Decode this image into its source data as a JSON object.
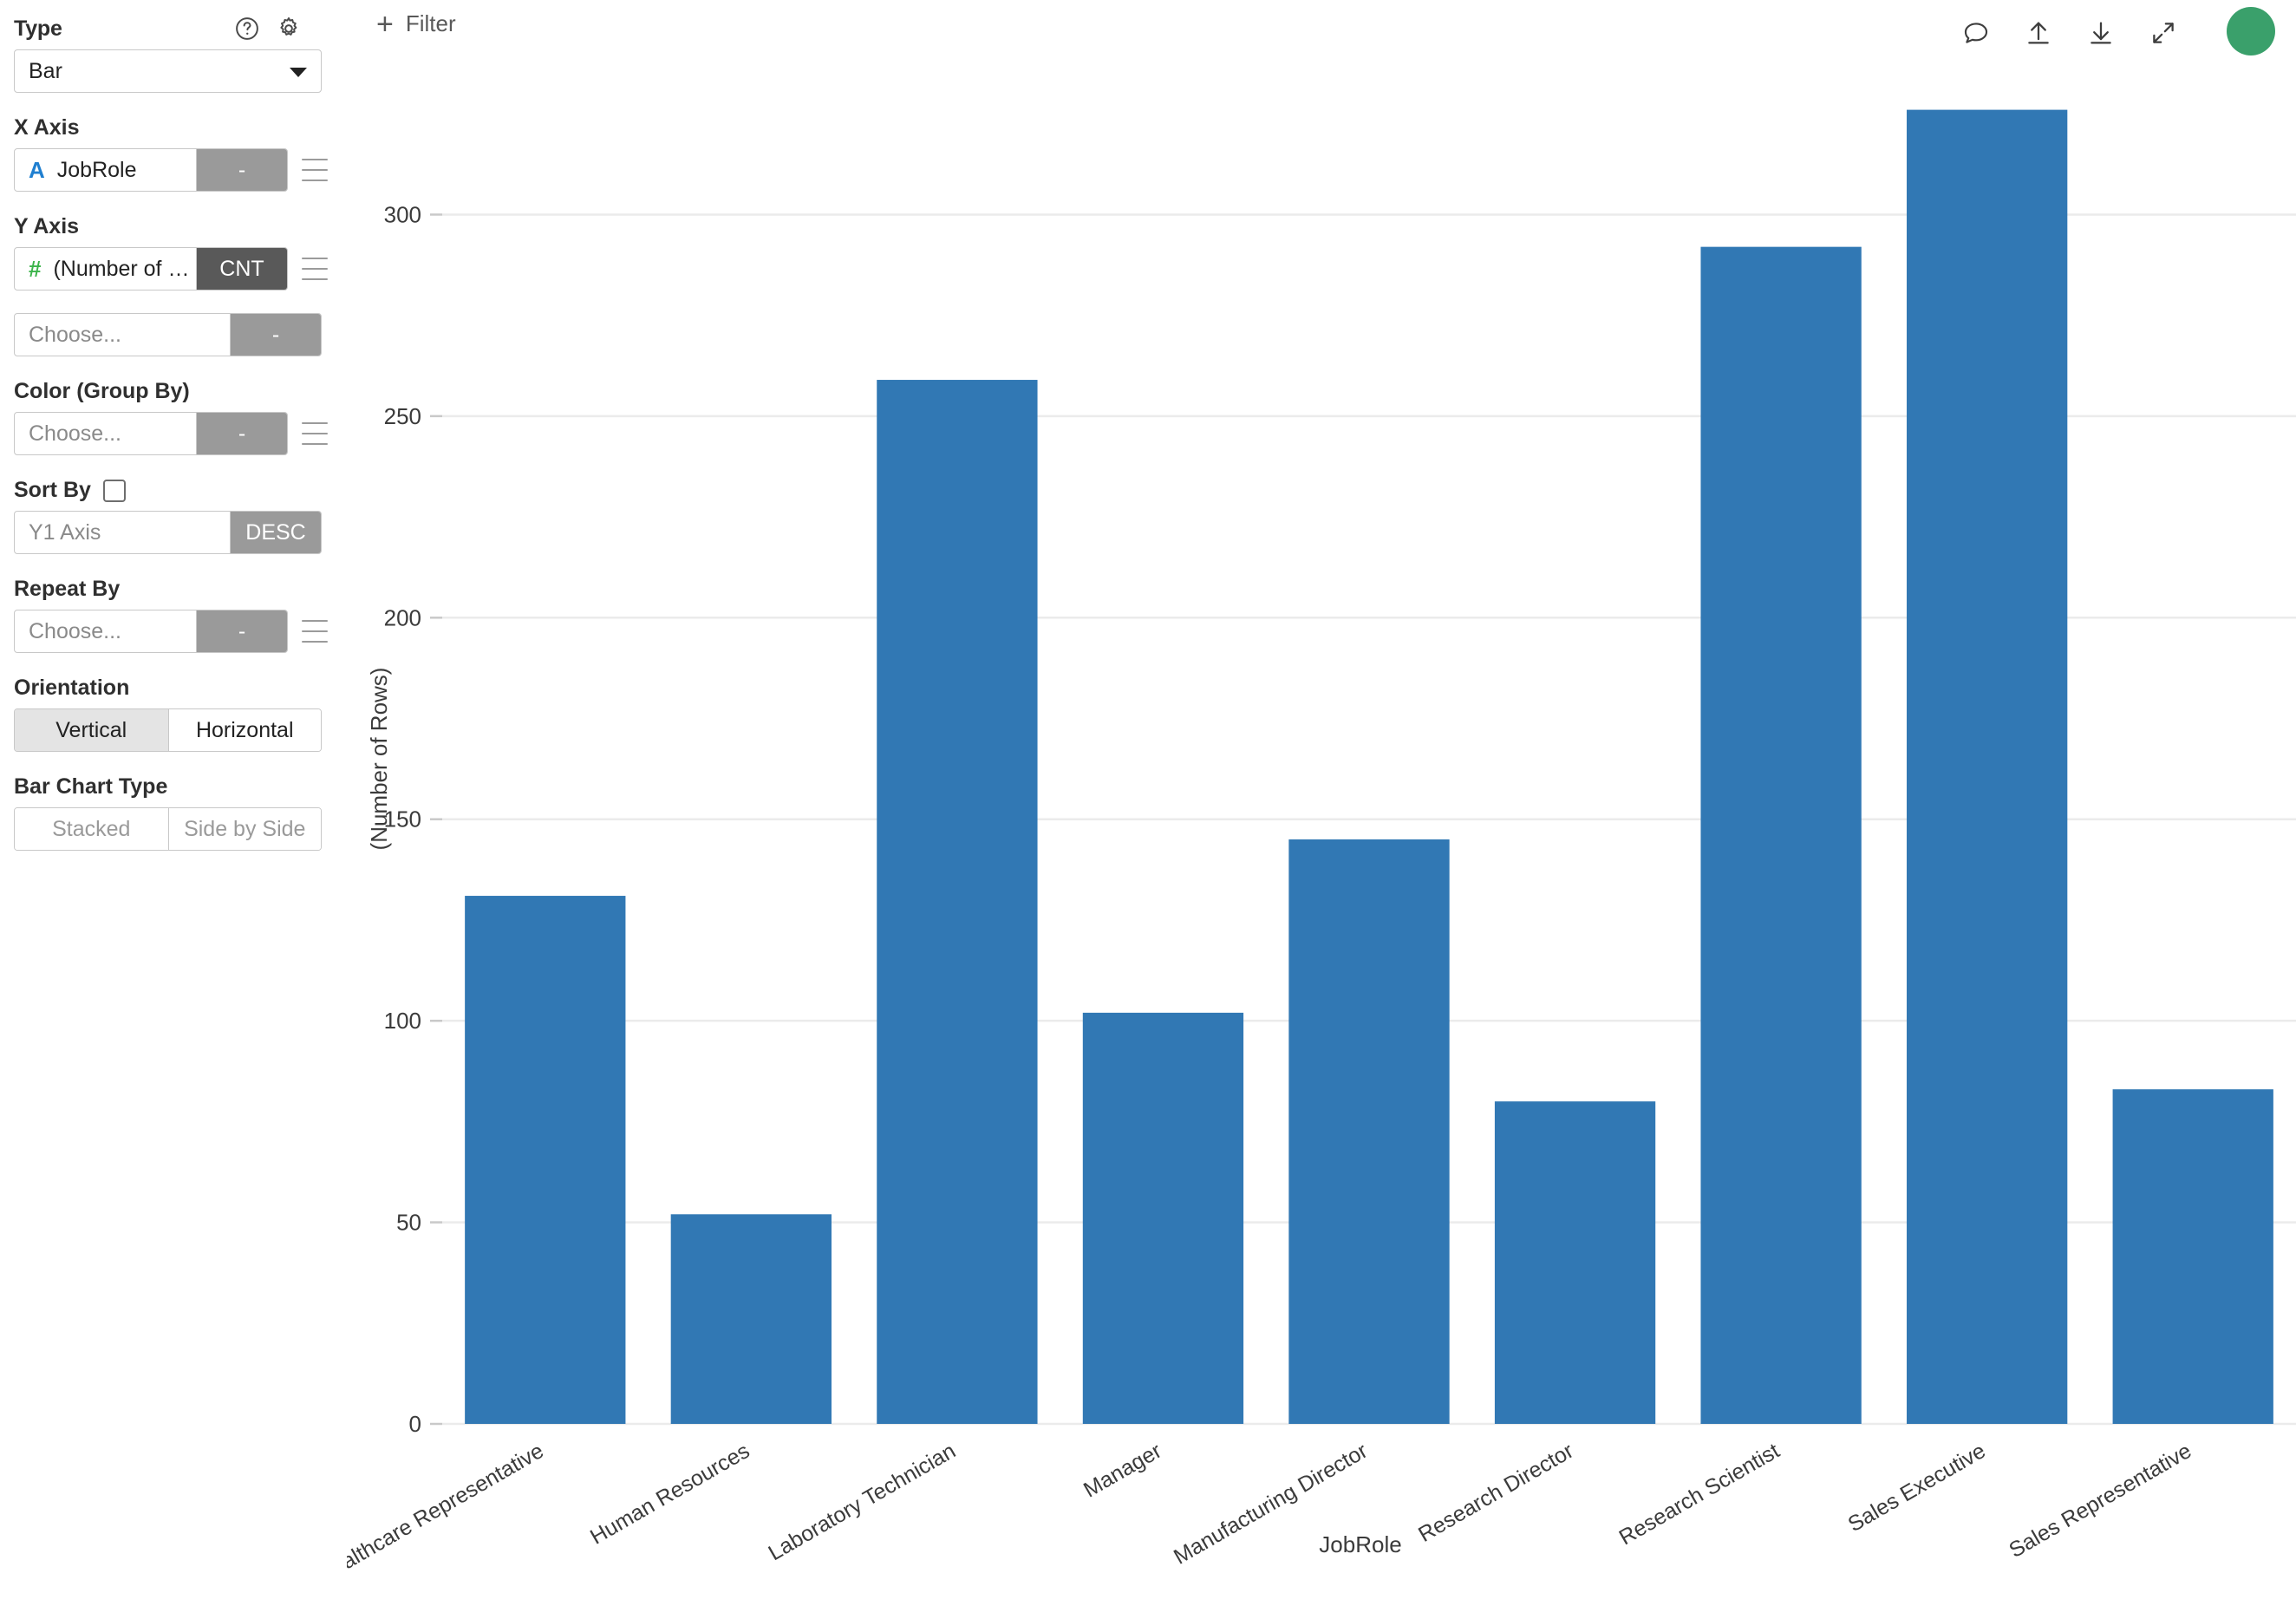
{
  "sidebar": {
    "type": {
      "label": "Type",
      "value": "Bar",
      "help_icon": "question-circle-icon",
      "settings_icon": "gear-icon"
    },
    "x_axis": {
      "label": "X Axis",
      "field": "JobRole",
      "field_type_mark": "A",
      "aggregate": "-"
    },
    "y_axis": {
      "label": "Y Axis",
      "field": "(Number of Rows)",
      "field_type_mark": "#",
      "aggregate": "CNT",
      "extra_field": "Choose...",
      "extra_aggregate": "-"
    },
    "color_group_by": {
      "label": "Color (Group By)",
      "field": "Choose...",
      "aggregate": "-"
    },
    "sort_by": {
      "label": "Sort By",
      "checked": false,
      "field": "Y1 Axis",
      "direction": "DESC"
    },
    "repeat_by": {
      "label": "Repeat By",
      "field": "Choose...",
      "aggregate": "-"
    },
    "orientation": {
      "label": "Orientation",
      "options": [
        "Vertical",
        "Horizontal"
      ],
      "selected": "Vertical"
    },
    "bar_chart_type": {
      "label": "Bar Chart Type",
      "options": [
        "Stacked",
        "Side by Side"
      ],
      "selected": null,
      "disabled": true
    }
  },
  "toolbar": {
    "filter_label": "Filter",
    "add_icon": "plus-icon",
    "icons": [
      "comment-icon",
      "upload-icon",
      "download-icon",
      "expand-icon"
    ],
    "avatar_color": "#3aa06b"
  },
  "chart_data": {
    "type": "bar",
    "title": "",
    "xlabel": "JobRole",
    "ylabel": "(Number of Rows)",
    "categories": [
      "Healthcare Representative",
      "Human Resources",
      "Laboratory Technician",
      "Manager",
      "Manufacturing Director",
      "Research Director",
      "Research Scientist",
      "Sales Executive",
      "Sales Representative"
    ],
    "values": [
      131,
      52,
      259,
      102,
      145,
      80,
      292,
      326,
      83
    ],
    "ylim": [
      0,
      330
    ],
    "yticks": [
      0,
      50,
      100,
      150,
      200,
      250,
      300
    ],
    "ytick_labels": [
      "0",
      "50",
      "100",
      "150",
      "200",
      "250",
      "300"
    ],
    "grid": true,
    "legend": null,
    "bar_color": "#3178b4",
    "xtick_rotation": -30
  }
}
